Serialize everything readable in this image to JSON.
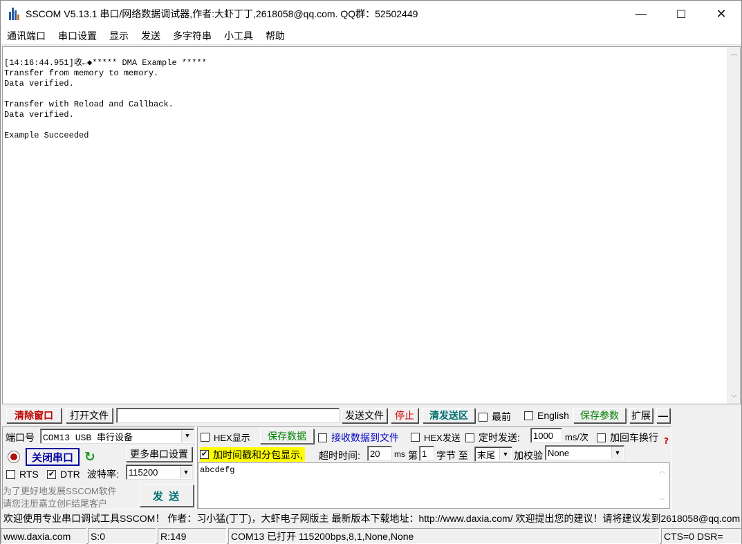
{
  "window": {
    "title": "SSCOM V5.13.1 串口/网络数据调试器,作者:大虾丁丁,2618058@qq.com. QQ群：52502449",
    "minimize": "—",
    "maximize": "☐",
    "close": "✕"
  },
  "menu": [
    "通讯端口",
    "串口设置",
    "显示",
    "发送",
    "多字符串",
    "小工具",
    "帮助"
  ],
  "receive": {
    "text": "[14:16:44.951]收←◆***** DMA Example *****\nTransfer from memory to memory.\nData verified.\n\nTransfer with Reload and Callback.\nData verified.\n\nExample Succeeded"
  },
  "toolbar": {
    "clear_window": "清除窗口",
    "open_file": "打开文件",
    "file_path": "",
    "send_file": "发送文件",
    "stop": "停止",
    "clear_send": "清发送区",
    "top_most": "最前",
    "english": "English",
    "save_params": "保存参数",
    "expand": "扩展",
    "collapse": "—"
  },
  "port": {
    "port_label": "端口号",
    "port_value": "COM13 USB 串行设备",
    "close_port": "关闭串口",
    "more_settings": "更多串口设置",
    "rts": "RTS",
    "dtr": "DTR",
    "baud_label": "波特率:",
    "baud_value": "115200",
    "promo_line1": "为了更好地发展SSCOM软件",
    "promo_line2": "请您注册嘉立创F结尾客户",
    "send": "发 送"
  },
  "options": {
    "hex_display": "HEX显示",
    "save_data": "保存数据",
    "recv_to_file": "接收数据到文件",
    "hex_send": "HEX发送",
    "timed_send": "定时发送:",
    "interval": "1000",
    "interval_unit": "ms/次",
    "add_crlf": "加回车换行",
    "timestamp": "加时间戳和分包显示,",
    "timeout_label": "超时时间:",
    "timeout": "20",
    "timeout_unit": "ms",
    "nth_label": "第",
    "nth": "1",
    "byte_label": "字节 至",
    "end_value": "末尾",
    "checksum_label": "加校验",
    "checksum_value": "None"
  },
  "send_area": {
    "text": "abcdefg"
  },
  "ticker": "欢迎使用专业串口调试工具SSCOM！ 作者：习小猛(丁丁)，大虾电子网版主  最新版本下载地址：http://www.daxia.com/ 欢迎提出您的建议！请将建议发到2618058@qq.com",
  "status": {
    "site": "www.daxia.com",
    "sent": "S:0",
    "received": "R:149",
    "port_state": "COM13 已打开  115200bps,8,1,None,None",
    "lines": "CTS=0 DSR="
  },
  "colors": {
    "clear_red": "#c00000",
    "stop_red": "#d00000",
    "clear_send_teal": "#007070",
    "save_green": "#008000",
    "recv_file_blue": "#0000c0",
    "highlight_yellow": "#ffff00",
    "close_port_blue": "#0000a0",
    "refresh_green": "#1c9a1c"
  }
}
